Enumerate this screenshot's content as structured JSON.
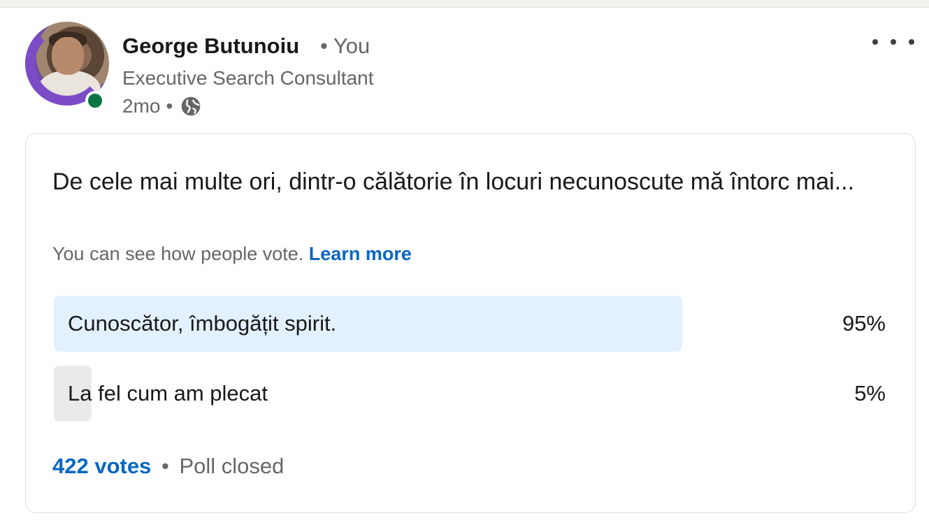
{
  "author": {
    "name": "George Butunoiu",
    "you_label": "• You",
    "headline": "Executive Search Consultant",
    "time": "2mo",
    "meta_separator": "•",
    "visibility_icon": "globe-icon",
    "online_status_color": "#057642"
  },
  "post": {
    "more_icon": "more-horizontal-icon"
  },
  "poll": {
    "question": "De cele mai multe ori, dintr-o călătorie în locuri necunoscute mă întorc mai...",
    "note": "You can see how people vote.",
    "learn_more": "Learn more",
    "options": [
      {
        "label": "Cunoscător, îmbogățit spirit.",
        "percent_label": "95%",
        "percent": 95,
        "bar_color": "#e3f0fd"
      },
      {
        "label": "La fel cum am plecat",
        "percent_label": "5%",
        "percent": 5,
        "bar_color": "#eaeaea"
      }
    ],
    "votes": "422 votes",
    "footer_separator": "•",
    "status": "Poll closed"
  },
  "colors": {
    "link": "#0a66c2",
    "text": "#191919",
    "secondary_text": "#666666"
  }
}
